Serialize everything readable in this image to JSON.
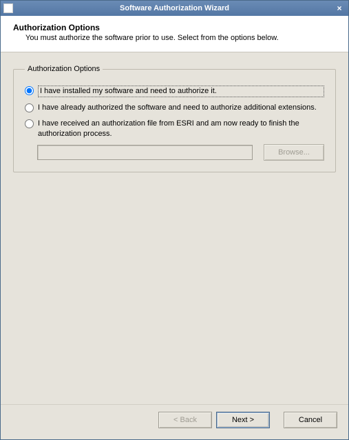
{
  "window": {
    "title": "Software Authorization Wizard",
    "close_glyph": "×"
  },
  "header": {
    "title": "Authorization Options",
    "subtitle": "You must authorize the software prior to use. Select from the options below."
  },
  "group": {
    "legend": "Authorization Options",
    "options": [
      {
        "label": "I have installed my software and need to authorize it.",
        "checked": true
      },
      {
        "label": "I have already authorized the software and need to authorize additional extensions.",
        "checked": false
      },
      {
        "label": "I have received an authorization file from ESRI and am now ready to finish the authorization process.",
        "checked": false
      }
    ],
    "file_value": "",
    "browse_label": "Browse..."
  },
  "footer": {
    "back_label": "< Back",
    "next_label": "Next >",
    "cancel_label": "Cancel"
  }
}
